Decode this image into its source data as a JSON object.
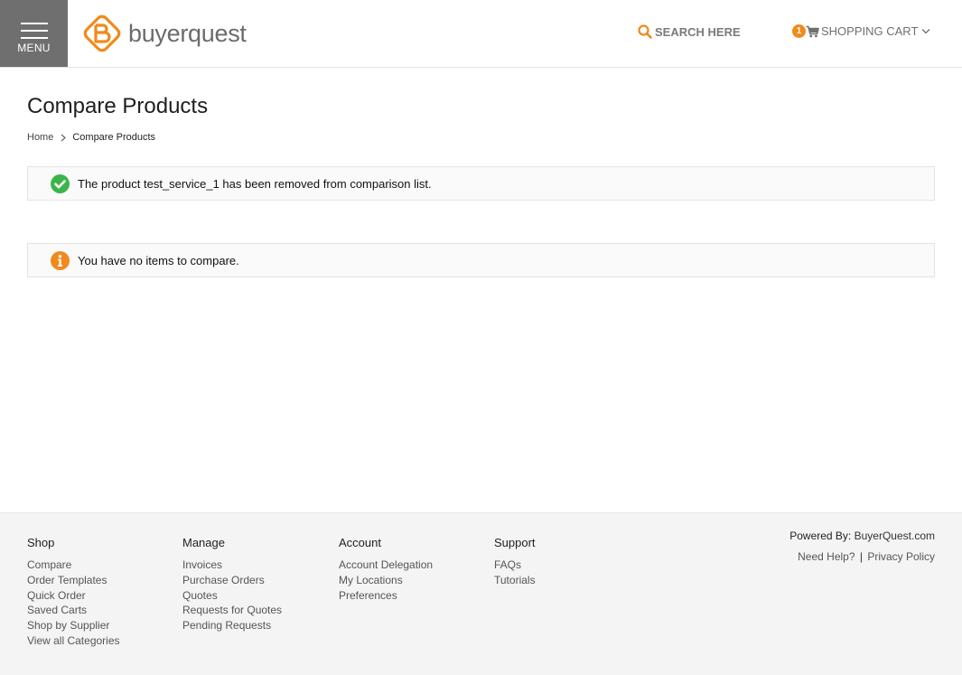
{
  "header": {
    "menu_label": "MENU",
    "logo_text": "buyerquest",
    "search_label": "SEARCH HERE",
    "cart_count": "1",
    "cart_label": "SHOPPING CART"
  },
  "main": {
    "title": "Compare Products",
    "breadcrumb": {
      "home": "Home",
      "current": "Compare Products"
    },
    "messages": {
      "success": "The product test_service_1 has been removed from comparison list.",
      "info": "You have no items to compare."
    }
  },
  "footer": {
    "columns": [
      {
        "heading": "Shop",
        "links": [
          "Compare",
          "Order Templates",
          "Quick Order",
          "Saved Carts",
          "Shop by Supplier",
          "View all Categories"
        ]
      },
      {
        "heading": "Manage",
        "links": [
          "Invoices",
          "Purchase Orders",
          "Quotes",
          "Requests for Quotes",
          "Pending Requests"
        ]
      },
      {
        "heading": "Account",
        "links": [
          "Account Delegation",
          "My Locations",
          "Preferences"
        ]
      },
      {
        "heading": "Support",
        "links": [
          "FAQs",
          "Tutorials"
        ]
      }
    ],
    "powered_label": "Powered By:",
    "powered_link": "BuyerQuest.com",
    "help_link": "Need Help?",
    "help_separator": "|",
    "privacy_link": "Privacy Policy"
  },
  "icons": {
    "menu": "hamburger-icon",
    "logo": "buyerquest-logo",
    "search": "search-icon",
    "cart": "shopping-cart-icon",
    "chevron": "chevron-down-icon",
    "breadcrumb_sep": "chevron-right-icon",
    "success": "check-circle-icon",
    "info": "info-circle-icon"
  },
  "colors": {
    "brand_orange": "#f08a1c",
    "success_green": "#3bb54a",
    "menu_gray": "#6f6f6f",
    "footer_bg": "#f4f4f4"
  }
}
